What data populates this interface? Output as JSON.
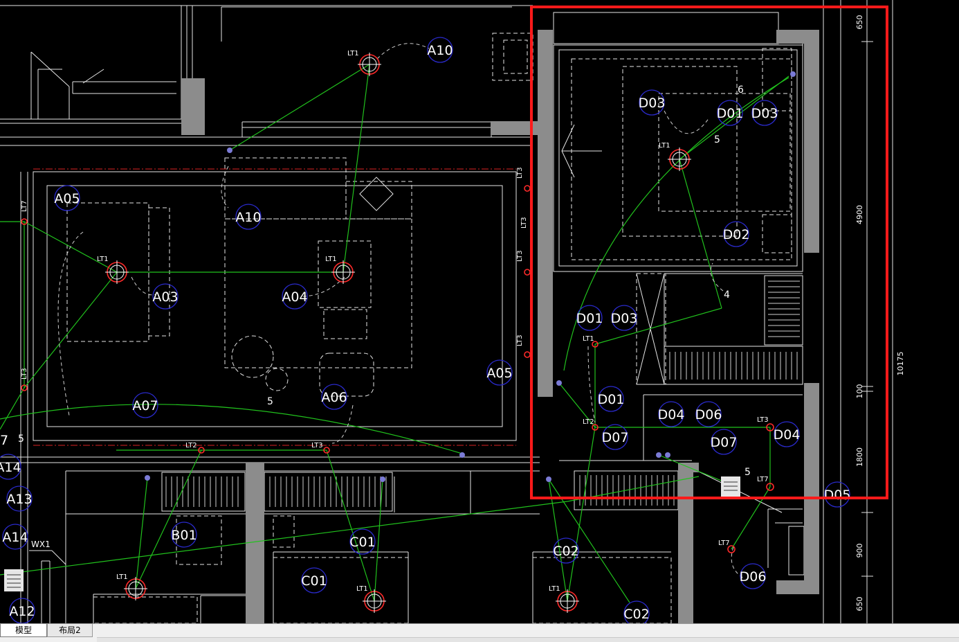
{
  "tabs": [
    {
      "label": "模型",
      "active": true
    },
    {
      "label": "布局2",
      "active": false
    }
  ],
  "colors": {
    "background": "#000000",
    "wire": "#21c21d",
    "wall": "#808080",
    "tag_ring": "#2a2acc",
    "fixture": "#ff2a2a",
    "highlight": "#ff1a1a",
    "linework": "#e8e8e8"
  },
  "tags": [
    "A10",
    "A05",
    "A10",
    "A03",
    "A04",
    "A05",
    "A06",
    "A07",
    "A14",
    "A13",
    "A14",
    "A12",
    "B01",
    "C01",
    "C01",
    "C02",
    "C02",
    "D03",
    "D01",
    "D03",
    "D02",
    "D01",
    "D03",
    "D01",
    "D04",
    "D06",
    "D07",
    "D07",
    "D04",
    "D05",
    "D06"
  ],
  "fixture_labels": [
    "LT1",
    "LT1",
    "LT1",
    "LT1",
    "LT1",
    "LT1",
    "LT1",
    "LT1",
    "LT2",
    "LT2",
    "LT3",
    "LT3",
    "LT7",
    "LT7",
    "LT7",
    "LT3",
    "LT3",
    "LT3",
    "LT3",
    "LT3"
  ],
  "annotations": {
    "wx_label": "WX1",
    "wire_numbers": [
      "5",
      "5",
      "5",
      "4",
      "6",
      "5"
    ],
    "left_partial": "7"
  },
  "dimensions": [
    "650",
    "4900",
    "10175",
    "100",
    "1800",
    "900",
    "650"
  ]
}
